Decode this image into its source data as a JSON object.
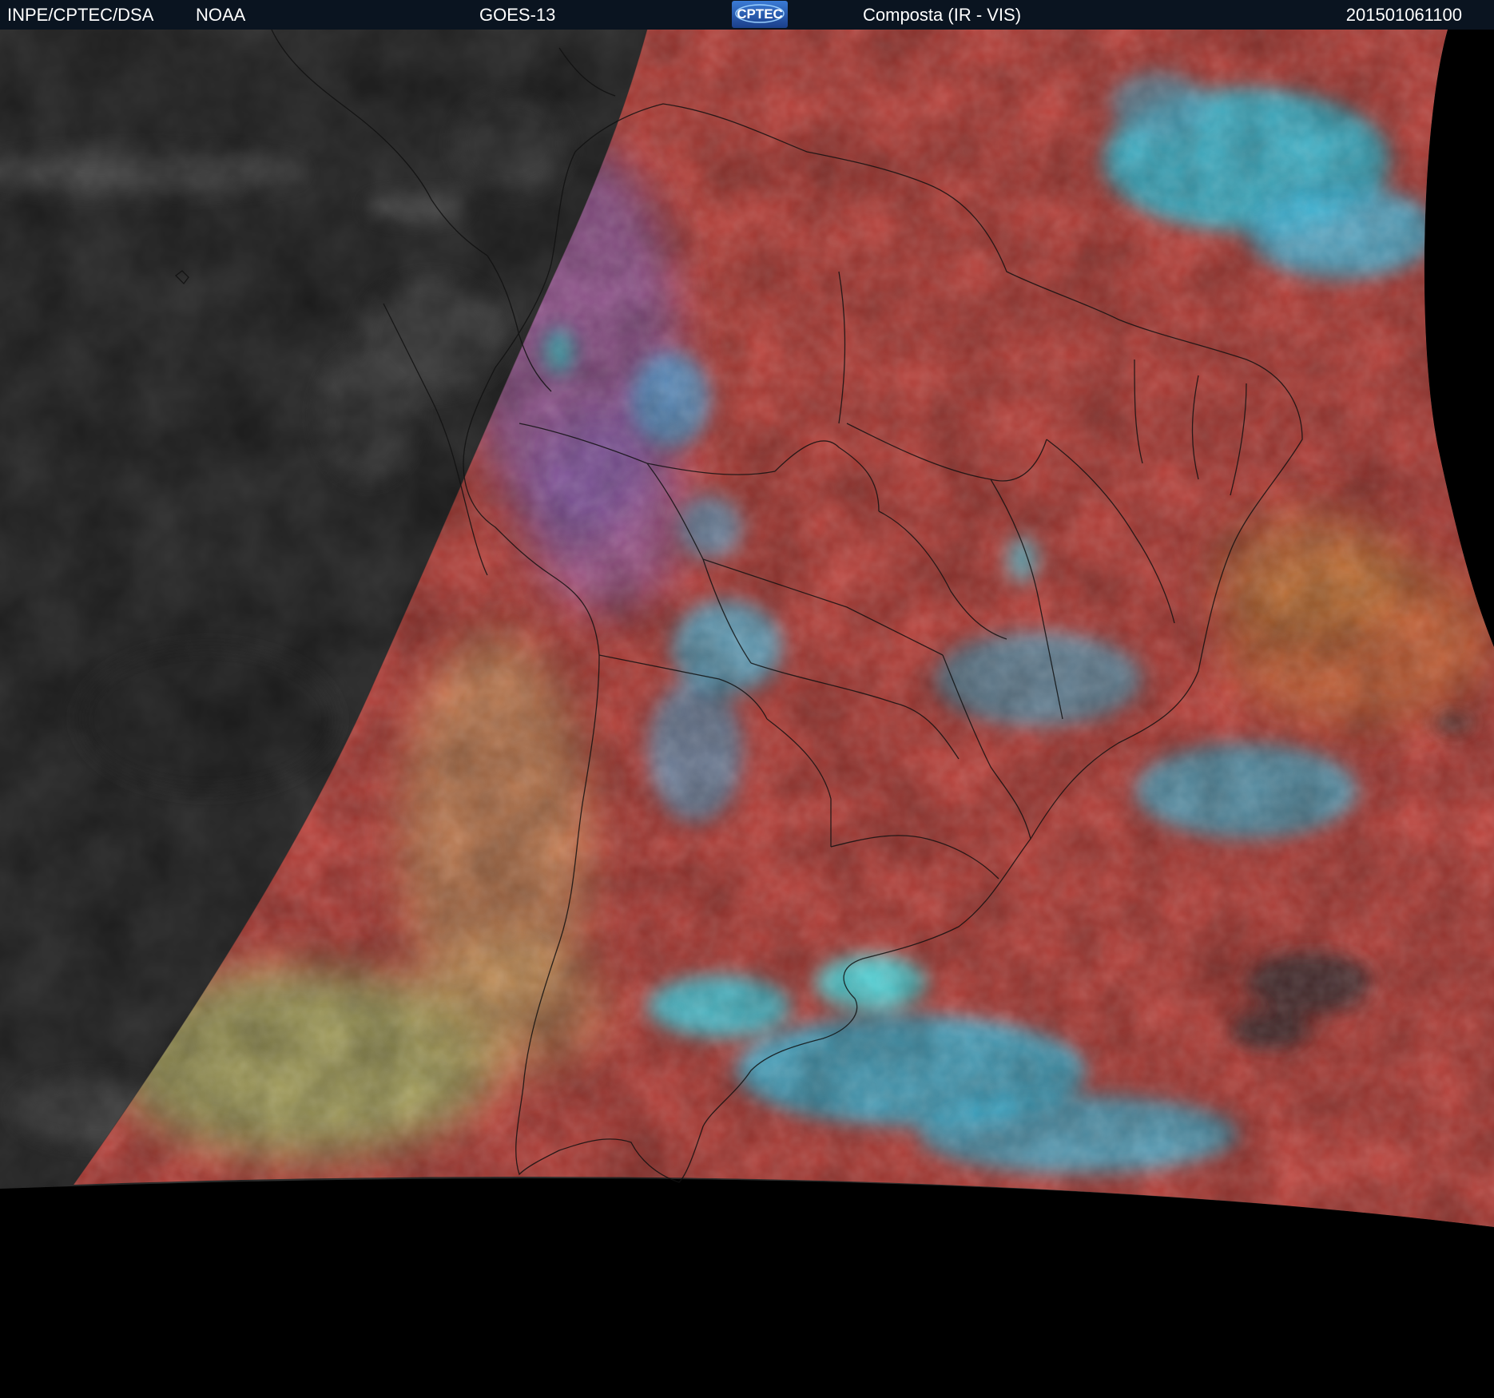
{
  "header": {
    "organization": "INPE/CPTEC/DSA",
    "agency": "NOAA",
    "satellite": "GOES-13",
    "logo_text": "CPTEC",
    "product": "Composta (IR - VIS)",
    "timestamp": "201501061100"
  },
  "colors": {
    "header_bg": "#0a1420",
    "night_side": "#3a3a3a",
    "land_ocean_composite": "#c2453e",
    "high_cloud": "#33d6f2",
    "low_cloud": "#9ed06a",
    "space": "#000000"
  }
}
